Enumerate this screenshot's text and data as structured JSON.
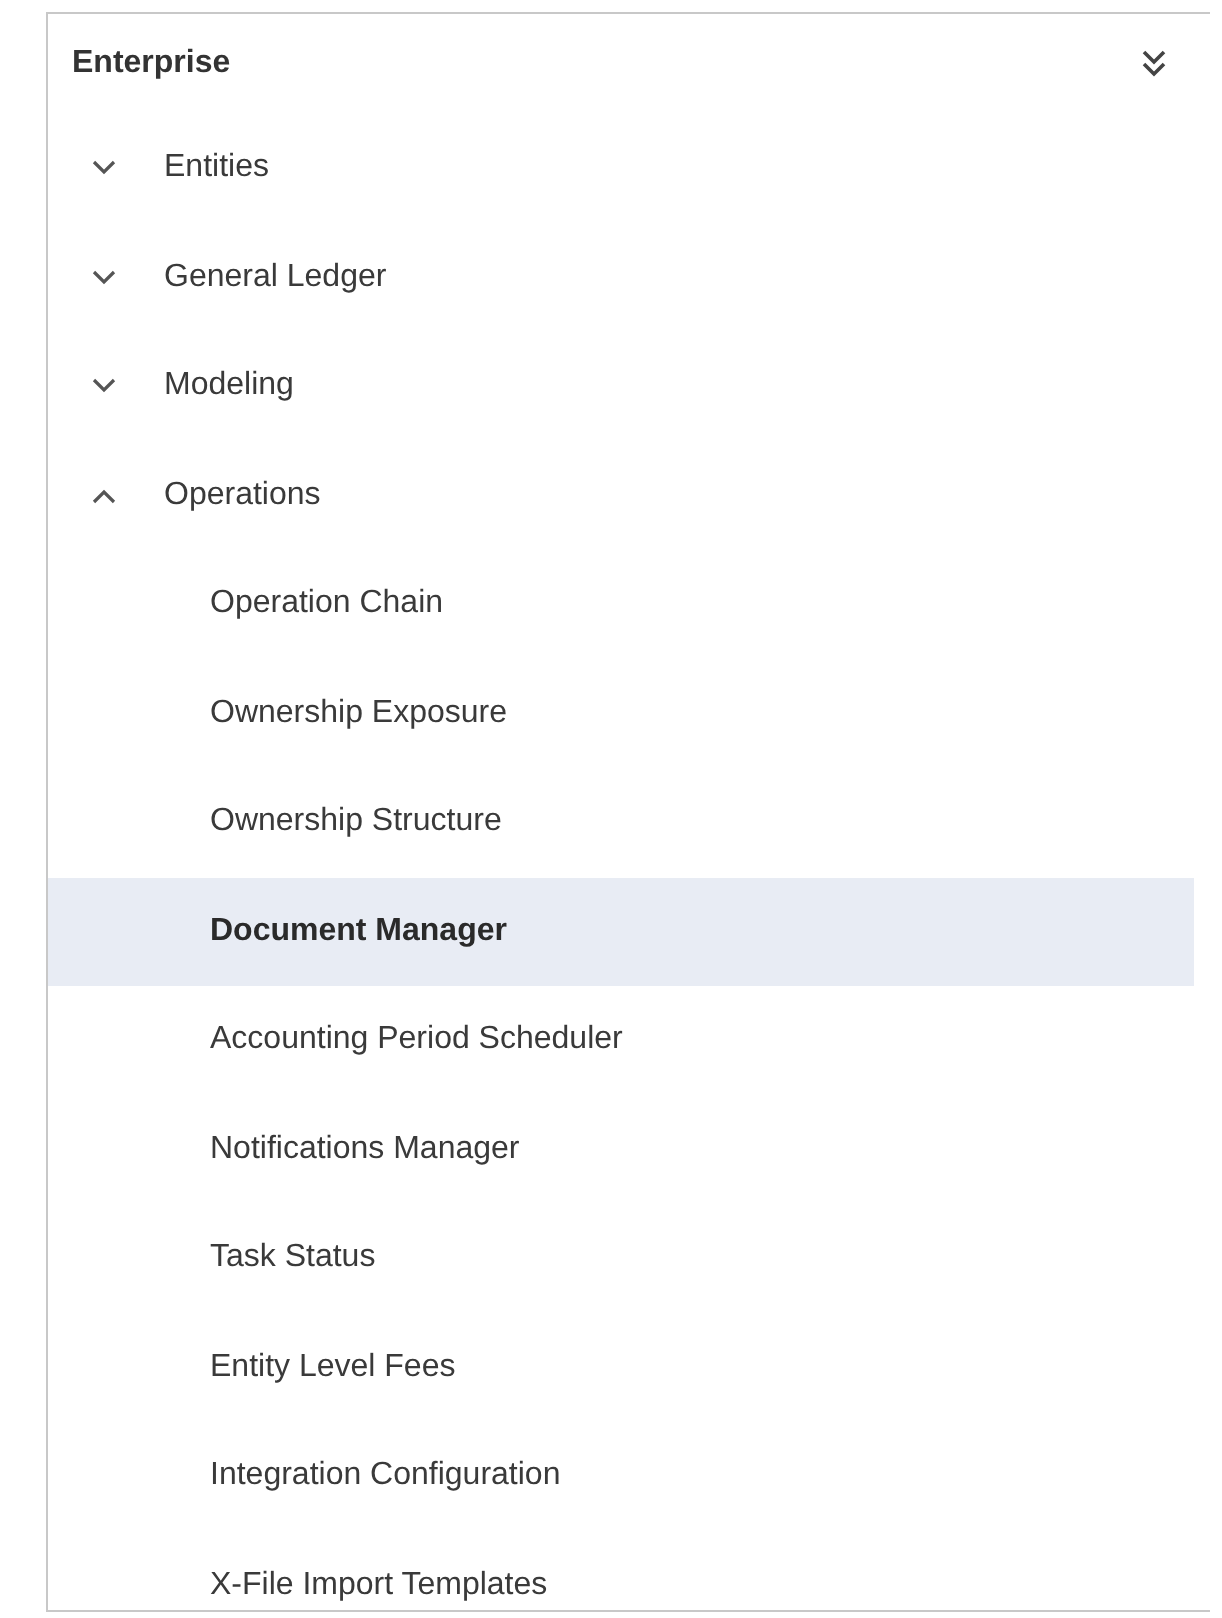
{
  "panel": {
    "title": "Enterprise"
  },
  "items": [
    {
      "label": "Entities",
      "expanded": false,
      "selected": false
    },
    {
      "label": "General Ledger",
      "expanded": false,
      "selected": false
    },
    {
      "label": "Modeling",
      "expanded": false,
      "selected": false
    },
    {
      "label": "Operations",
      "expanded": true,
      "selected": false,
      "children": [
        {
          "label": "Operation Chain",
          "selected": false
        },
        {
          "label": "Ownership Exposure",
          "selected": false
        },
        {
          "label": "Ownership Structure",
          "selected": false
        },
        {
          "label": "Document Manager",
          "selected": true
        },
        {
          "label": "Accounting Period Scheduler",
          "selected": false
        },
        {
          "label": "Notifications Manager",
          "selected": false
        },
        {
          "label": "Task Status",
          "selected": false
        },
        {
          "label": "Entity Level Fees",
          "selected": false
        },
        {
          "label": "Integration Configuration",
          "selected": false
        },
        {
          "label": "X-File Import Templates",
          "selected": false
        }
      ]
    }
  ]
}
